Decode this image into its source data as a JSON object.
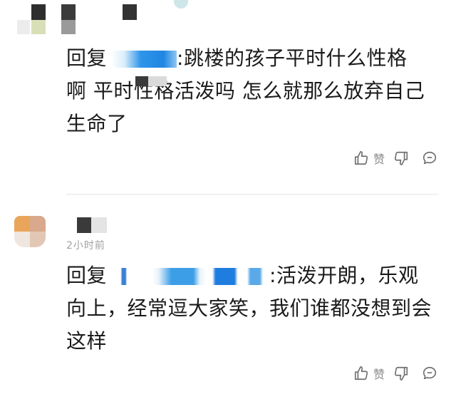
{
  "comments": [
    {
      "reply_prefix": "回复",
      "lines": [
        ":跳楼的孩子平时什么性格",
        "啊 平时性格活泼吗 怎么就那么放弃自己",
        "生命了"
      ],
      "actions": {
        "like_label": "赞"
      }
    },
    {
      "timestamp": "2小时前",
      "reply_prefix": "回复",
      "lines": [
        ":活泼开朗，乐观",
        "向上，经常逗大家笑，我们谁都没想到会",
        "这样"
      ],
      "actions": {
        "like_label": "赞"
      }
    }
  ],
  "icons": {
    "like": "thumbs-up-icon",
    "dislike": "thumbs-down-icon",
    "reply": "comment-bubble-icon"
  },
  "colors": {
    "text": "#1b1b1b",
    "muted": "#8a8a8a",
    "mosaic_blue": "#2a8fe6",
    "mosaic_dark": "#3a3a3a"
  }
}
